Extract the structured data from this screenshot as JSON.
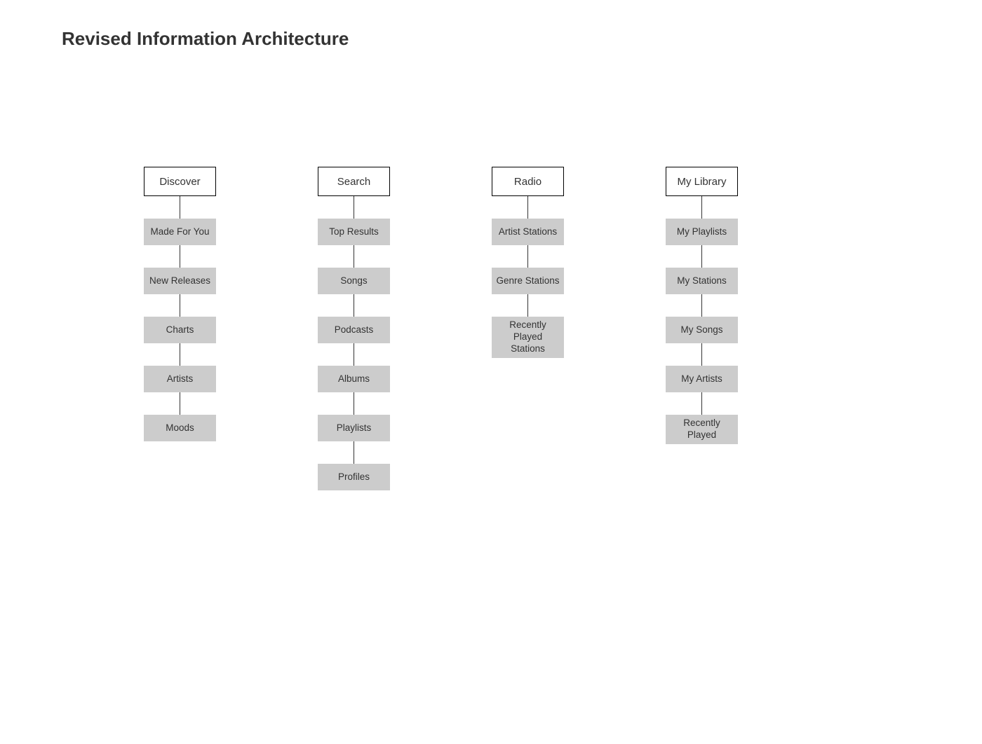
{
  "title": "Revised Information Architecture",
  "columns": [
    {
      "header": "Discover",
      "children": [
        "Made For You",
        "New Releases",
        "Charts",
        "Artists",
        "Moods"
      ]
    },
    {
      "header": "Search",
      "children": [
        "Top Results",
        "Songs",
        "Podcasts",
        "Albums",
        "Playlists",
        "Profiles"
      ]
    },
    {
      "header": "Radio",
      "children": [
        "Artist Stations",
        "Genre Stations",
        "Recently Played Stations"
      ]
    },
    {
      "header": "My Library",
      "children": [
        "My Playlists",
        "My Stations",
        "My Songs",
        "My Artists",
        "Recently Played"
      ]
    }
  ]
}
